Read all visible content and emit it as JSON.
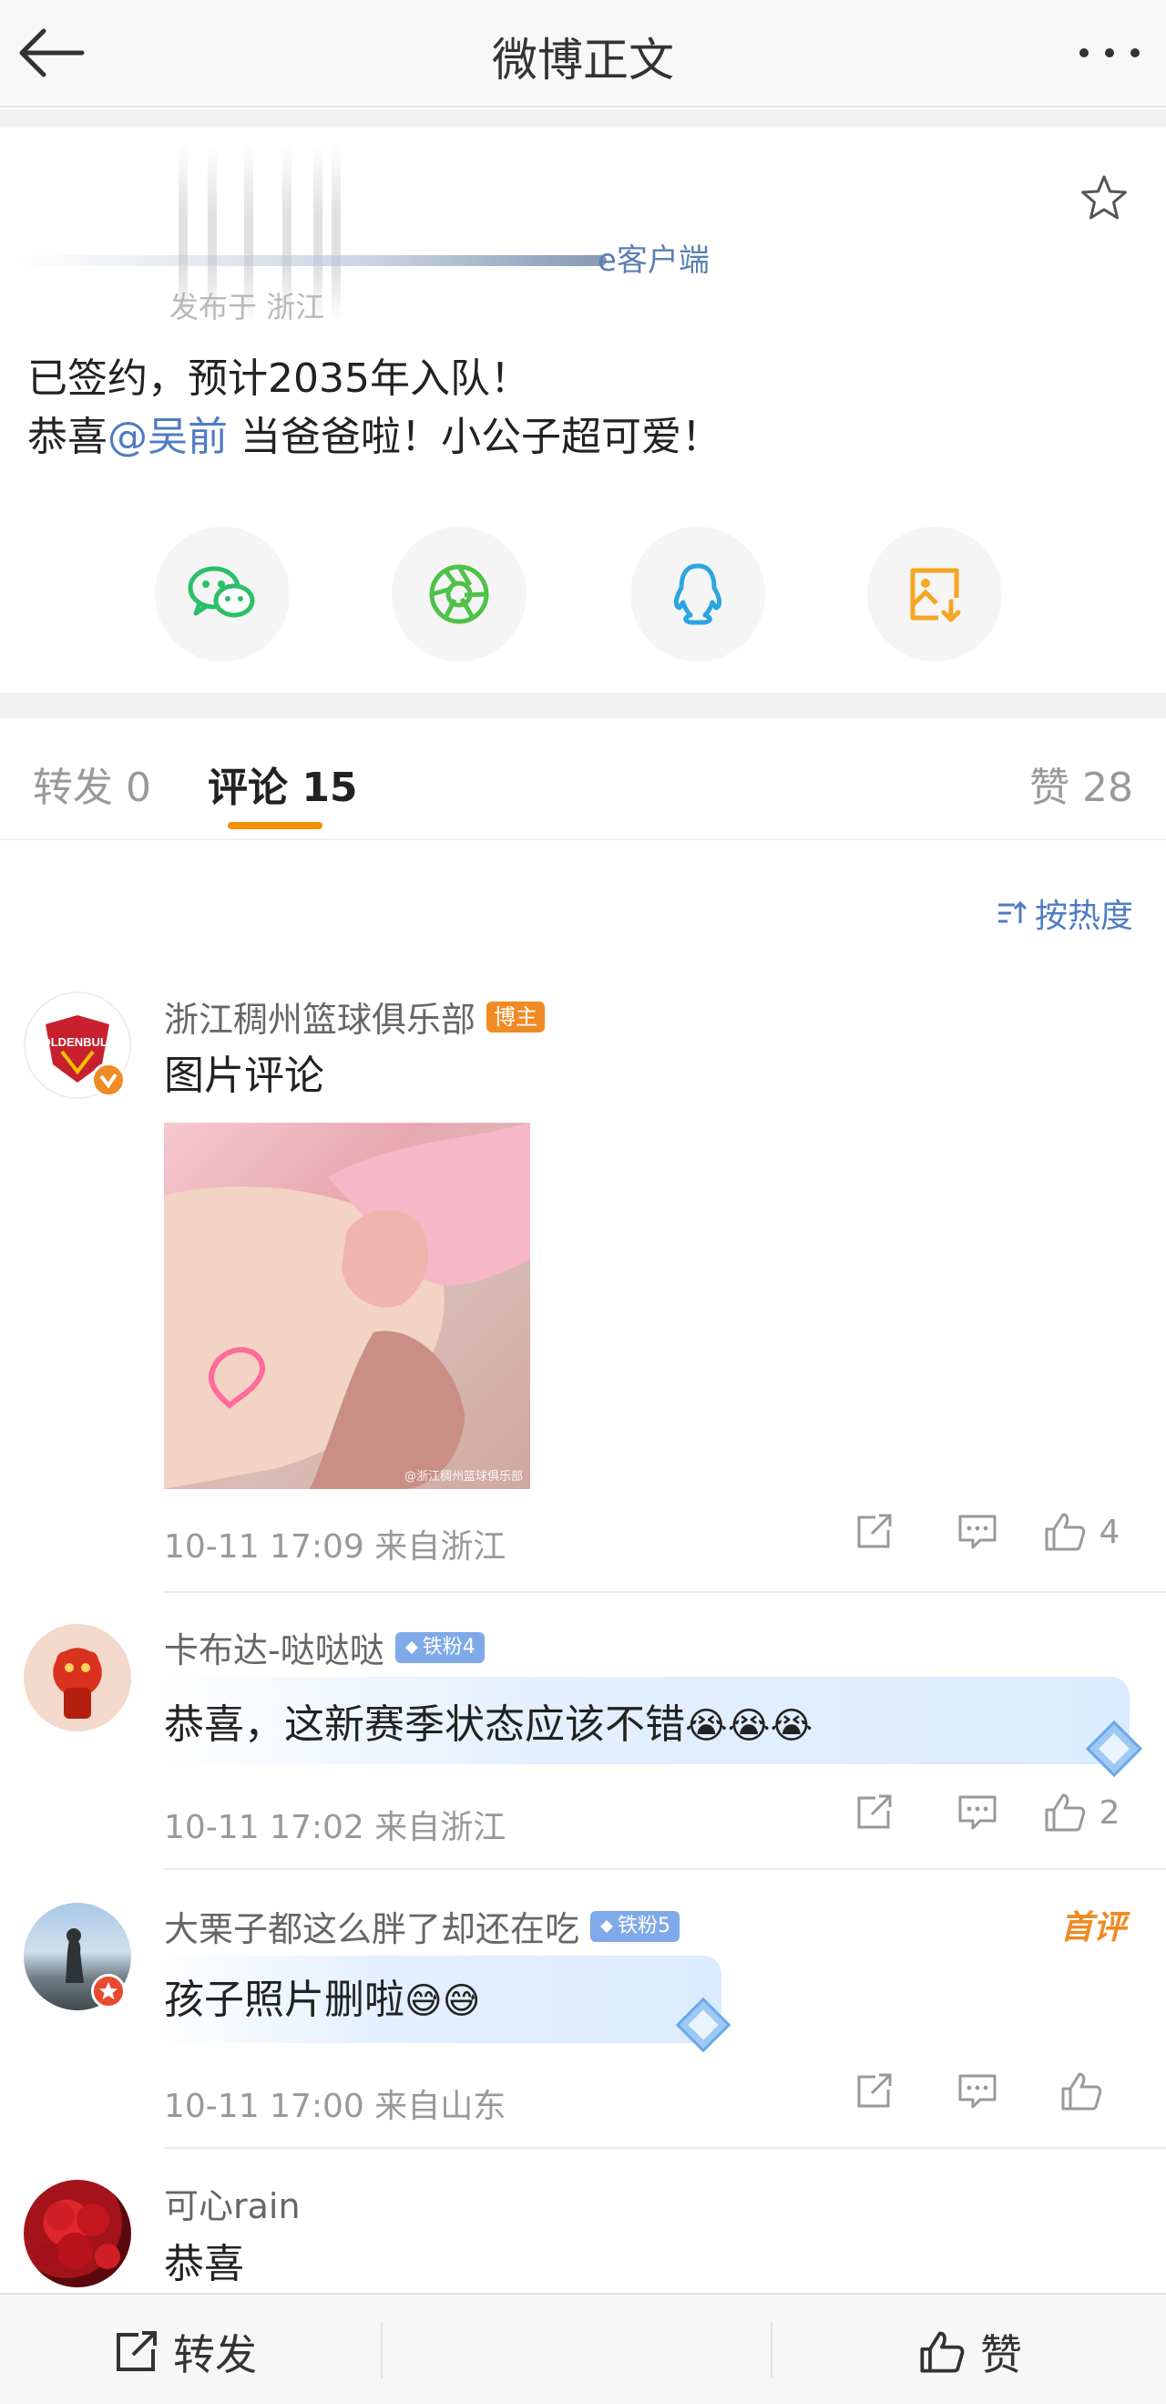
{
  "nav": {
    "title": "微博正文",
    "back_icon": "arrow-left-icon",
    "more_icon": "more-dots-icon"
  },
  "post": {
    "client": "e客户端",
    "location": "发布于 浙江",
    "line1": "已签约，预计2035年入队！",
    "line2_prefix": "恭喜",
    "mention": "@吴前",
    "line2_suffix": " 当爸爸啦！小公子超可爱！",
    "share_buttons": [
      {
        "name": "wechat",
        "color": "#2bbf6a"
      },
      {
        "name": "moments",
        "color": "#4dc247"
      },
      {
        "name": "qq",
        "color": "#2ba6e0"
      },
      {
        "name": "save-image",
        "color": "#f5a623"
      }
    ]
  },
  "tabs": {
    "repost": "转发 0",
    "comment": "评论 15",
    "like": "赞 28"
  },
  "sort": {
    "label": "按热度"
  },
  "comments": [
    {
      "name": "浙江稠州篮球俱乐部",
      "badge": "博主",
      "text": "图片评论",
      "image_watermark": "@浙江稠州篮球俱乐部",
      "time": "10-11 17:09 来自浙江",
      "likes": "4"
    },
    {
      "name": "卡布达-哒哒哒",
      "fan_badge": "铁粉4",
      "text": "恭喜，这新赛季状态应该不错",
      "time": "10-11 17:02 来自浙江",
      "likes": "2"
    },
    {
      "name": "大栗子都这么胖了却还在吃",
      "fan_badge": "铁粉5",
      "first_badge": "首评",
      "text": "孩子照片删啦",
      "time": "10-11 17:00 来自山东",
      "likes": ""
    },
    {
      "name": "可心rain",
      "text": "恭喜"
    }
  ],
  "bottom": {
    "repost": "转发",
    "like": "赞"
  }
}
